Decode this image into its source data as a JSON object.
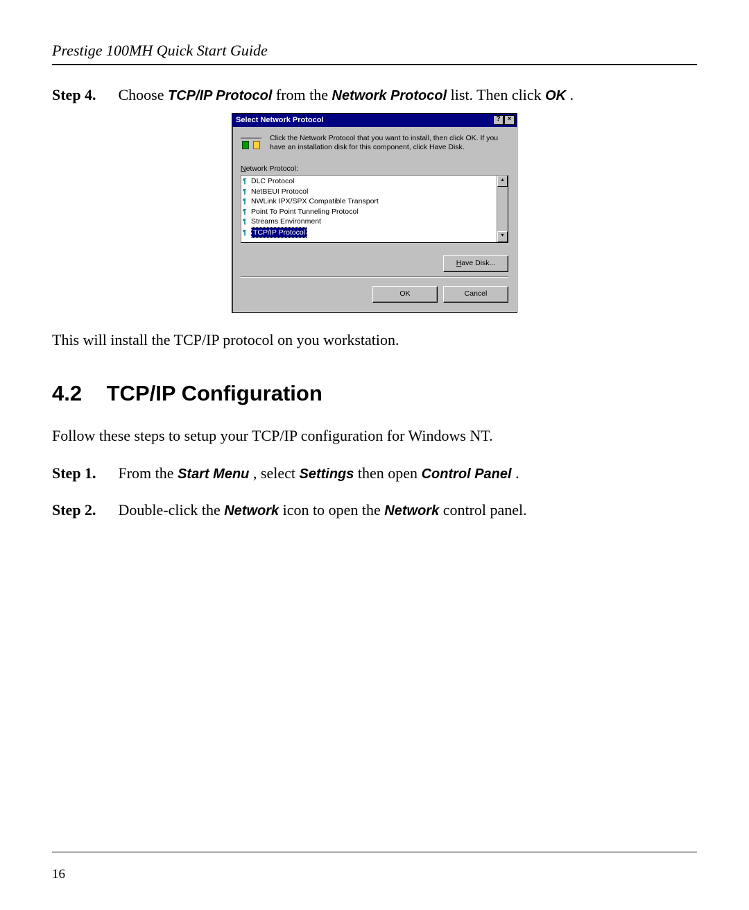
{
  "header": "Prestige 100MH Quick Start Guide",
  "page_number": "16",
  "step4": {
    "label": "Step 4.",
    "pre": "Choose ",
    "b1": "TCP/IP Protocol",
    "mid": " from the ",
    "b2": "Network Protocol",
    "post": " list. Then click ",
    "b3": "OK",
    "end": "."
  },
  "dialog": {
    "title": "Select Network Protocol",
    "help": "?",
    "close": "×",
    "instruction": "Click the Network Protocol that you want to install, then click OK. If you have an installation disk for this component, click Have Disk.",
    "list_label_u": "N",
    "list_label_rest": "etwork Protocol:",
    "items": [
      "DLC Protocol",
      "NetBEUI Protocol",
      "NWLink IPX/SPX Compatible Transport",
      "Point To Point Tunneling Protocol",
      "Streams Environment",
      "TCP/IP Protocol"
    ],
    "scroll_up": "▴",
    "scroll_down": "▾",
    "have_disk_u": "H",
    "have_disk_rest": "ave Disk...",
    "ok": "OK",
    "cancel": "Cancel"
  },
  "after_dialog": "This will install the TCP/IP protocol on you workstation.",
  "section": {
    "num": "4.2",
    "title": "TCP/IP Configuration"
  },
  "section_intro": "Follow these steps to setup your TCP/IP configuration for Windows NT.",
  "step1": {
    "label": "Step 1.",
    "pre": "From the ",
    "b1": "Start Menu",
    "mid": ", select ",
    "b2": "Settings",
    "post": " then open ",
    "b3": "Control Panel",
    "end": "."
  },
  "step2": {
    "label": "Step 2.",
    "pre": "Double-click the ",
    "b1": "Network",
    "mid": " icon to open the ",
    "b2": "Network",
    "post": " control panel."
  }
}
